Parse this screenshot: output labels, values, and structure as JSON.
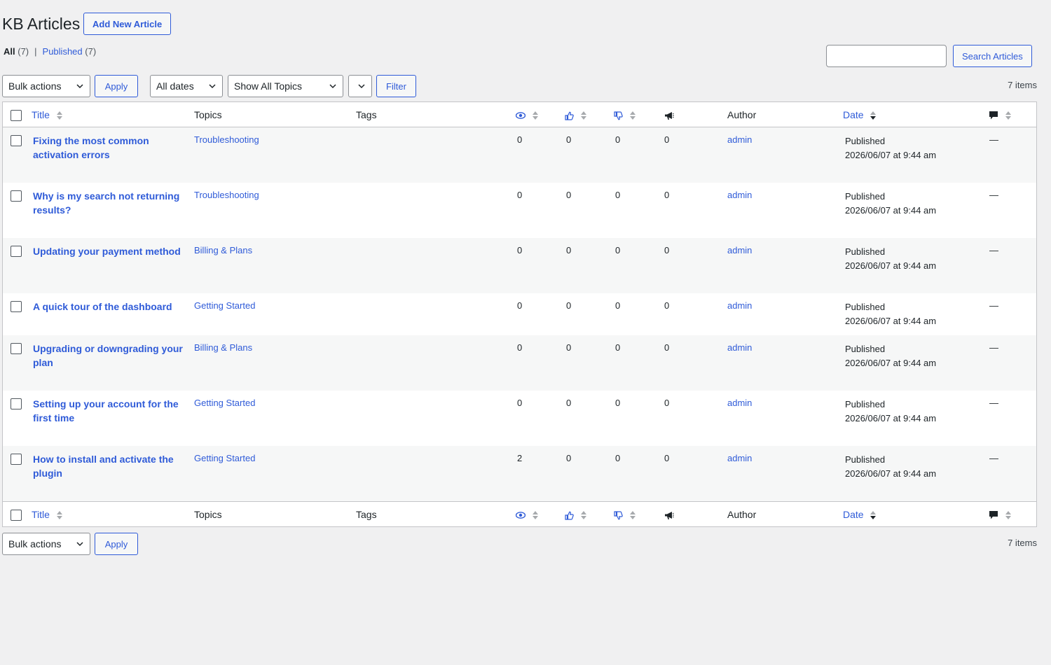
{
  "header": {
    "title": "KB Articles",
    "add_new_label": "Add New Article"
  },
  "filters_nav": {
    "all_label": "All",
    "all_count": "(7)",
    "separator": "|",
    "published_label": "Published",
    "published_count": "(7)"
  },
  "search": {
    "value": "",
    "button_label": "Search Articles"
  },
  "top_controls": {
    "bulk_actions": "Bulk actions",
    "apply_label": "Apply",
    "dates_select": "All dates",
    "topics_select": "Show All Topics",
    "filter_label": "Filter",
    "items_count": "7 items"
  },
  "columns": {
    "title": "Title",
    "topics": "Topics",
    "tags": "Tags",
    "views_icon": "eye-icon",
    "upvotes_icon": "thumbs-up-icon",
    "downvotes_icon": "thumbs-down-icon",
    "feedback_icon": "megaphone-icon",
    "author": "Author",
    "date": "Date",
    "comments_icon": "comment-icon"
  },
  "rows": [
    {
      "title": "Fixing the most common activation errors",
      "topic": "Troubleshooting",
      "views": "0",
      "up": "0",
      "down": "0",
      "feedback": "0",
      "author": "admin",
      "status": "Published",
      "date": "2026/06/07 at 9:44 am",
      "comments": "—"
    },
    {
      "title": "Why is my search not returning results?",
      "topic": "Troubleshooting",
      "views": "0",
      "up": "0",
      "down": "0",
      "feedback": "0",
      "author": "admin",
      "status": "Published",
      "date": "2026/06/07 at 9:44 am",
      "comments": "—"
    },
    {
      "title": "Updating your payment method",
      "topic": "Billing & Plans",
      "views": "0",
      "up": "0",
      "down": "0",
      "feedback": "0",
      "author": "admin",
      "status": "Published",
      "date": "2026/06/07 at 9:44 am",
      "comments": "—"
    },
    {
      "title": "A quick tour of the dashboard",
      "topic": "Getting Started",
      "views": "0",
      "up": "0",
      "down": "0",
      "feedback": "0",
      "author": "admin",
      "status": "Published",
      "date": "2026/06/07 at 9:44 am",
      "comments": "—"
    },
    {
      "title": "Upgrading or downgrading your plan",
      "topic": "Billing & Plans",
      "views": "0",
      "up": "0",
      "down": "0",
      "feedback": "0",
      "author": "admin",
      "status": "Published",
      "date": "2026/06/07 at 9:44 am",
      "comments": "—"
    },
    {
      "title": "Setting up your account for the first time",
      "topic": "Getting Started",
      "views": "0",
      "up": "0",
      "down": "0",
      "feedback": "0",
      "author": "admin",
      "status": "Published",
      "date": "2026/06/07 at 9:44 am",
      "comments": "—"
    },
    {
      "title": "How to install and activate the plugin",
      "topic": "Getting Started",
      "views": "2",
      "up": "0",
      "down": "0",
      "feedback": "0",
      "author": "admin",
      "status": "Published",
      "date": "2026/06/07 at 9:44 am",
      "comments": "—"
    }
  ],
  "bottom_controls": {
    "bulk_actions": "Bulk actions",
    "apply_label": "Apply",
    "items_count": "7 items"
  },
  "colors": {
    "link": "#2f5bd8",
    "background": "#f0f0f1",
    "alt_row": "#f6f7f7",
    "border": "#c3c4c7"
  }
}
